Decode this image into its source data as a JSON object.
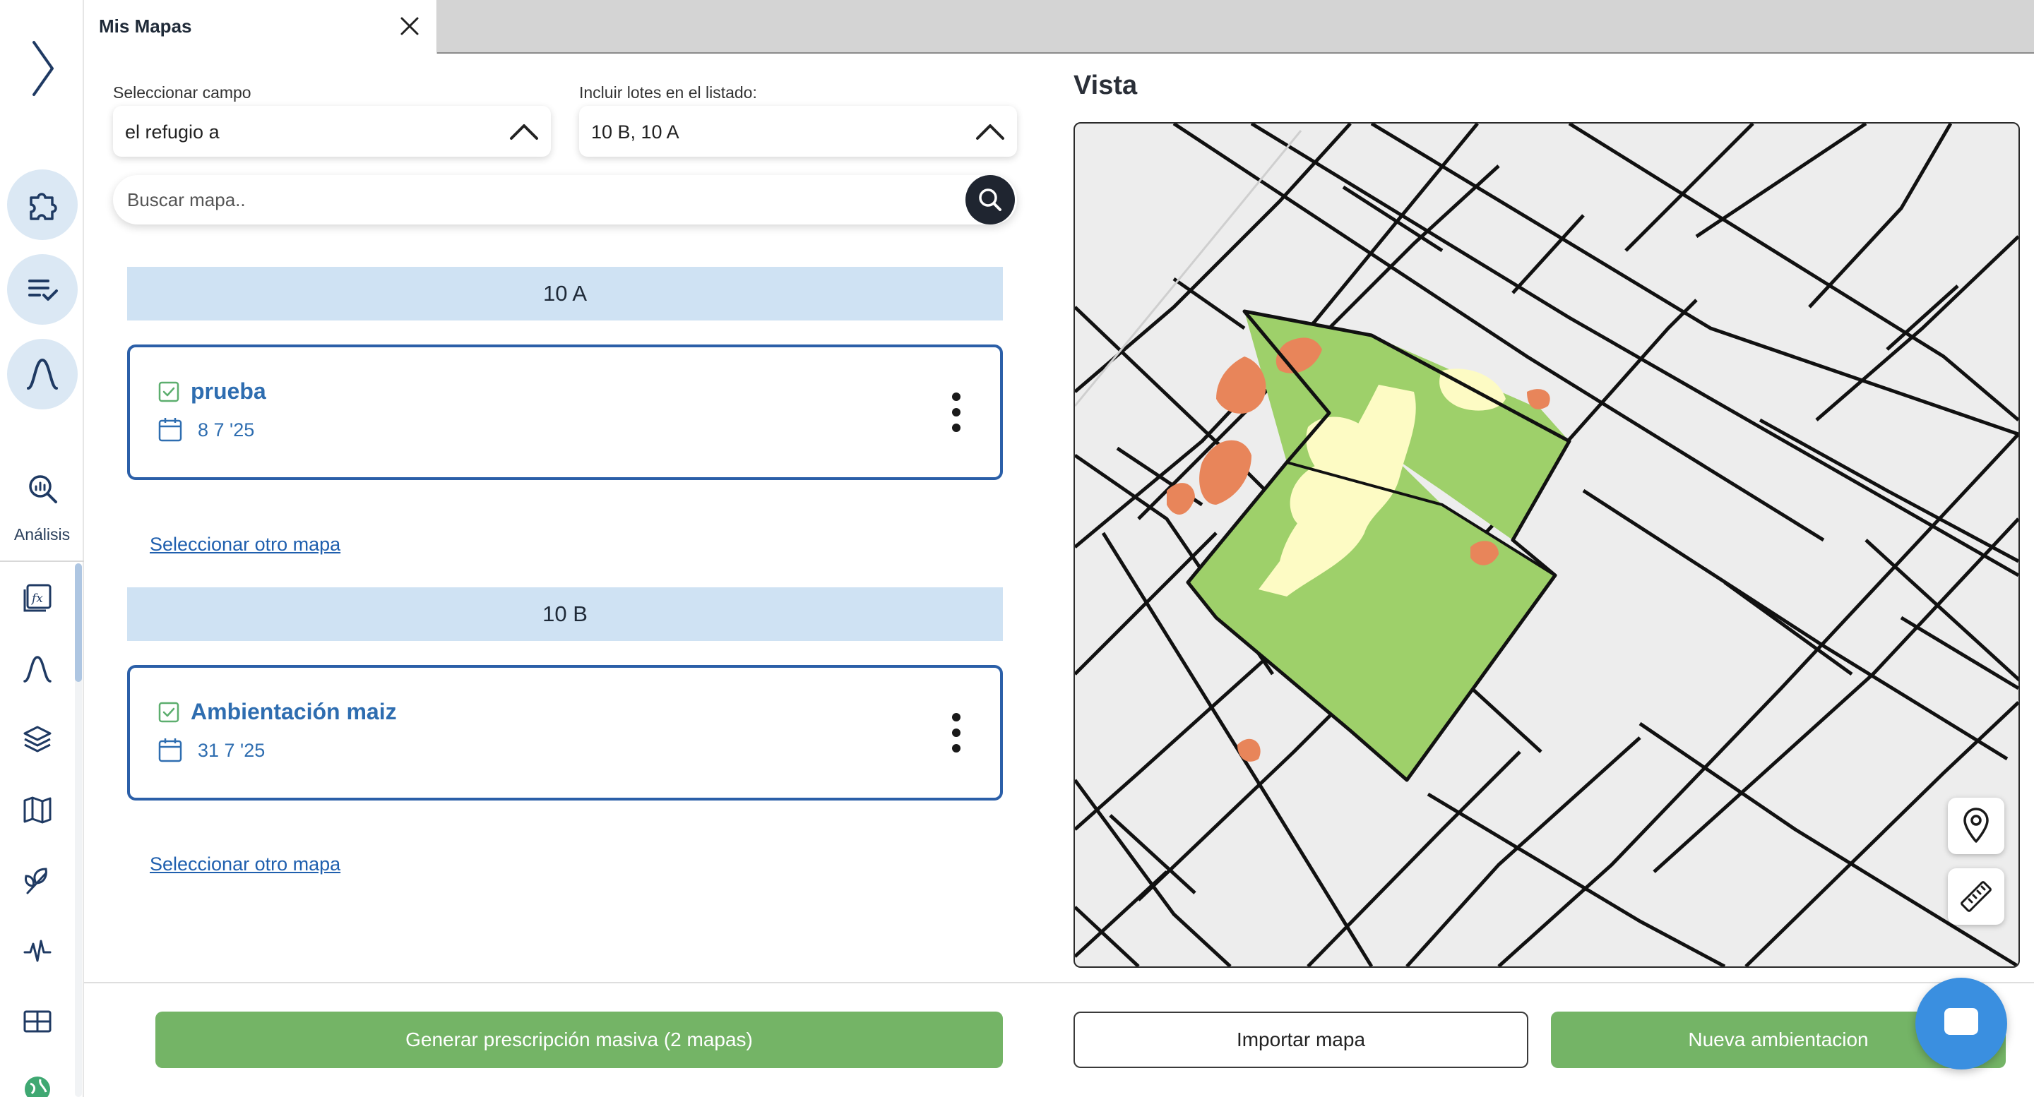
{
  "tab": {
    "title": "Mis Mapas"
  },
  "rail": {
    "analysis_label": "Análisis"
  },
  "filters": {
    "campo_label": "Seleccionar campo",
    "campo_value": "el refugio a",
    "lotes_label": "Incluir lotes en el listado:",
    "lotes_value": "10 B, 10 A"
  },
  "search": {
    "placeholder": "Buscar mapa.."
  },
  "groups": [
    {
      "header": "10 A",
      "map": {
        "name": "prueba",
        "date": "8 7 '25"
      },
      "link": "Seleccionar otro mapa"
    },
    {
      "header": "10 B",
      "map": {
        "name": "Ambientación maiz",
        "date": "31 7 '25"
      },
      "link": "Seleccionar otro mapa"
    }
  ],
  "preview": {
    "title": "Vista"
  },
  "footer": {
    "generate_label": "Generar prescripción masiva (2 mapas)",
    "import_label": "Importar mapa",
    "new_label": "Nueva ambientacion"
  },
  "colors": {
    "accent_blue": "#2e6db0",
    "header_blue": "#cfe2f3",
    "button_green": "#74b466",
    "zone_green": "#9ed06a",
    "zone_yellow": "#fdfbc4",
    "zone_orange": "#e8855a"
  },
  "icons": {
    "rail_expand": "chevron-right-icon",
    "rail_buttons": [
      "puzzle-icon",
      "checklist-icon",
      "curve-icon"
    ],
    "rail_tools": [
      "chart-formula-icon",
      "curve-icon",
      "layers-icon",
      "map-icon",
      "plant-icon",
      "pulse-icon",
      "grid-icon",
      "globe-icon"
    ],
    "search": "search-icon",
    "map_controls": [
      "location-pin-icon",
      "ruler-icon"
    ]
  }
}
